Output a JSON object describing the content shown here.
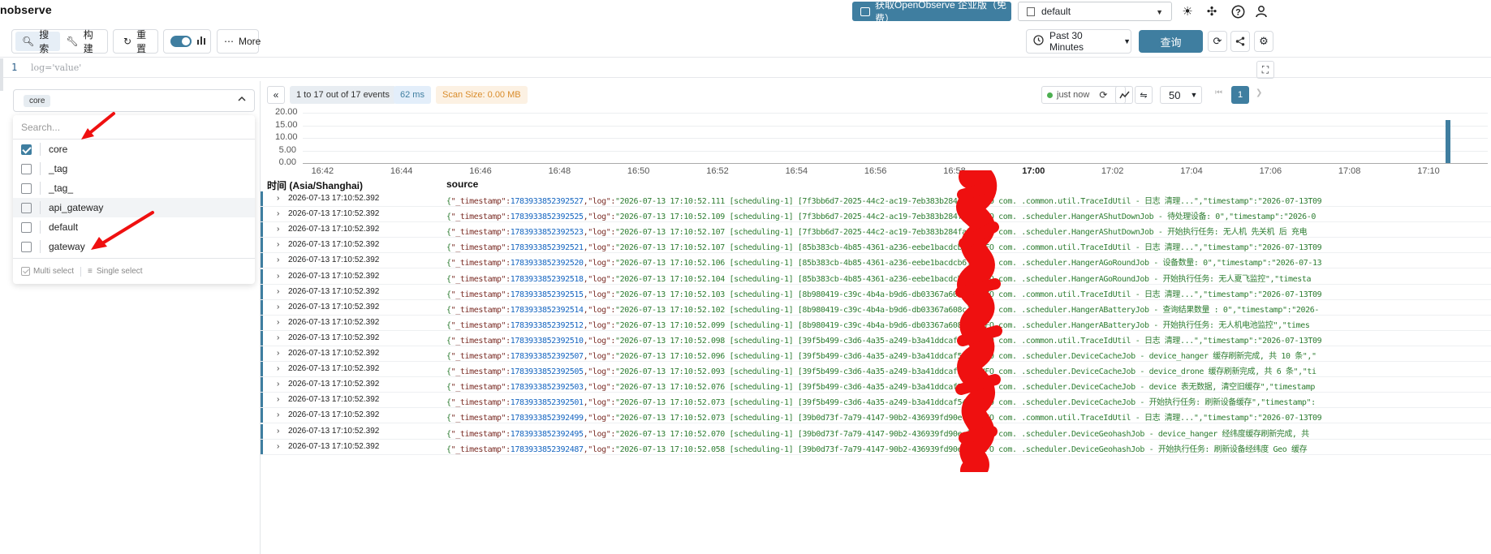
{
  "header": {
    "brand": "nobserve",
    "enterprise_btn": "获取OpenObserve 企业版（免费）",
    "org": "default"
  },
  "toolbar": {
    "search_label": "搜索",
    "build_label": "构建",
    "reset_label": "重置",
    "more_label": "More",
    "time_range": "Past 30 Minutes",
    "query_label": "查询"
  },
  "editor": {
    "line_number": "1",
    "placeholder": "log='value'"
  },
  "stream": {
    "selected_chip": "core",
    "search_placeholder": "Search...",
    "options": [
      {
        "label": "core",
        "checked": true
      },
      {
        "label": "_tag",
        "checked": false
      },
      {
        "label": "_tag_",
        "checked": false
      },
      {
        "label": "api_gateway",
        "checked": false
      },
      {
        "label": "default",
        "checked": false
      },
      {
        "label": "gateway",
        "checked": false
      }
    ],
    "multi_select": "Multi select",
    "single_select": "Single select"
  },
  "results": {
    "events_label": "1 to 17 out of 17 events",
    "took": "62 ms",
    "scan_size": "Scan Size: 0.00 MB",
    "refresh_label": "just now",
    "page_size": "50",
    "current_page": "1"
  },
  "chart_data": {
    "type": "bar",
    "y_ticks": [
      "20.00",
      "15.00",
      "10.00",
      "5.00",
      "0.00"
    ],
    "ylim": [
      0,
      20
    ],
    "x_ticks": [
      "16:42",
      "16:44",
      "16:46",
      "16:48",
      "16:50",
      "16:52",
      "16:54",
      "16:56",
      "16:58",
      "17:00",
      "17:02",
      "17:04",
      "17:06",
      "17:08",
      "17:10"
    ],
    "x_bold_tick": "17:00",
    "x_range": [
      "16:41.5",
      "17:11.5"
    ],
    "bars": [
      {
        "x": "17:10.5",
        "value": 17
      }
    ],
    "color": "#3f7ea0"
  },
  "table": {
    "col_time": "时间 (Asia/Shanghai)",
    "col_source": "source",
    "rows": [
      {
        "ts": "2026-07-13 17:10:52.392",
        "n": "1783933852392527",
        "src": "\"2026-07-13 17:10:52.111 [scheduling-1] [7f3bb6d7-2025-44c2-ac19-7eb383b284fa] INFO com.    .common.util.TraceIdUtil - 日志 清理...\",\"timestamp\":\"2026-07-13T09"
      },
      {
        "ts": "2026-07-13 17:10:52.392",
        "n": "1783933852392525",
        "src": "\"2026-07-13 17:10:52.109 [scheduling-1] [7f3bb6d7-2025-44c2-ac19-7eb383b284fa] INFO com.    .scheduler.HangerAShutDownJob - 待处理设备: 0\",\"timestamp\":\"2026-0"
      },
      {
        "ts": "2026-07-13 17:10:52.392",
        "n": "1783933852392523",
        "src": "\"2026-07-13 17:10:52.107 [scheduling-1] [7f3bb6d7-2025-44c2-ac19-7eb383b284fa] INFO com.    .scheduler.HangerAShutDownJob - 开始执行任务: 无人机 先关机 后 充电"
      },
      {
        "ts": "2026-07-13 17:10:52.392",
        "n": "1783933852392521",
        "src": "\"2026-07-13 17:10:52.107 [scheduling-1] [85b383cb-4b85-4361-a236-eebe1bacdcb6] INFO com.    .common.util.TraceIdUtil - 日志 清理...\",\"timestamp\":\"2026-07-13T09"
      },
      {
        "ts": "2026-07-13 17:10:52.392",
        "n": "1783933852392520",
        "src": "\"2026-07-13 17:10:52.106 [scheduling-1] [85b383cb-4b85-4361-a236-eebe1bacdcb6] INFO com.    .scheduler.HangerAGoRoundJob - 设备数量: 0\",\"timestamp\":\"2026-07-13"
      },
      {
        "ts": "2026-07-13 17:10:52.392",
        "n": "1783933852392518",
        "src": "\"2026-07-13 17:10:52.104 [scheduling-1] [85b383cb-4b85-4361-a236-eebe1bacdcb6] INFO com.    .scheduler.HangerAGoRoundJob - 开始执行任务: 无人夏飞监控\",\"timesta"
      },
      {
        "ts": "2026-07-13 17:10:52.392",
        "n": "1783933852392515",
        "src": "\"2026-07-13 17:10:52.103 [scheduling-1] [8b980419-c39c-4b4a-b9d6-db03367a608c] INFO com.    .common.util.TraceIdUtil - 日志 清理...\",\"timestamp\":\"2026-07-13T09"
      },
      {
        "ts": "2026-07-13 17:10:52.392",
        "n": "1783933852392514",
        "src": "\"2026-07-13 17:10:52.102 [scheduling-1] [8b980419-c39c-4b4a-b9d6-db03367a608c] INFO com.    .scheduler.HangerABatteryJob - 查询结果数量 : 0\",\"timestamp\":\"2026-"
      },
      {
        "ts": "2026-07-13 17:10:52.392",
        "n": "1783933852392512",
        "src": "\"2026-07-13 17:10:52.099 [scheduling-1] [8b980419-c39c-4b4a-b9d6-db03367a608c] INFO com.    .scheduler.HangerABatteryJob - 开始执行任务: 无人机电池监控\",\"times"
      },
      {
        "ts": "2026-07-13 17:10:52.392",
        "n": "1783933852392510",
        "src": "\"2026-07-13 17:10:52.098 [scheduling-1] [39f5b499-c3d6-4a35-a249-b3a41ddcaf54] INFO com.    .common.util.TraceIdUtil - 日志 清理...\",\"timestamp\":\"2026-07-13T09"
      },
      {
        "ts": "2026-07-13 17:10:52.392",
        "n": "1783933852392507",
        "src": "\"2026-07-13 17:10:52.096 [scheduling-1] [39f5b499-c3d6-4a35-a249-b3a41ddcaf54] INFO com.    .scheduler.DeviceCacheJob - device_hanger 缓存刷新完成, 共 10 条\",\""
      },
      {
        "ts": "2026-07-13 17:10:52.392",
        "n": "1783933852392505",
        "src": "\"2026-07-13 17:10:52.093 [scheduling-1] [39f5b499-c3d6-4a35-a249-b3a41ddcaf54] INFO com.    .scheduler.DeviceCacheJob - device_drone 缓存刷新完成, 共 6 条\",\"ti"
      },
      {
        "ts": "2026-07-13 17:10:52.392",
        "n": "1783933852392503",
        "src": "\"2026-07-13 17:10:52.076 [scheduling-1] [39f5b499-c3d6-4a35-a249-b3a41ddcaf54] INFO com.    .scheduler.DeviceCacheJob - device 表无数据, 清空旧缓存\",\"timestamp"
      },
      {
        "ts": "2026-07-13 17:10:52.392",
        "n": "1783933852392501",
        "src": "\"2026-07-13 17:10:52.073 [scheduling-1] [39f5b499-c3d6-4a35-a249-b3a41ddcaf54] INFO com.    .scheduler.DeviceCacheJob - 开始执行任务: 刷新设备缓存\",\"timestamp\":"
      },
      {
        "ts": "2026-07-13 17:10:52.392",
        "n": "1783933852392499",
        "src": "\"2026-07-13 17:10:52.073 [scheduling-1] [39b0d73f-7a79-4147-90b2-436939fd90ec] INFO com.    .common.util.TraceIdUtil - 日志 清理...\",\"timestamp\":\"2026-07-13T09"
      },
      {
        "ts": "2026-07-13 17:10:52.392",
        "n": "1783933852392495",
        "src": "\"2026-07-13 17:10:52.070 [scheduling-1] [39b0d73f-7a79-4147-90b2-436939fd90ec] INFO com.    .scheduler.DeviceGeohashJob - device_hanger 经纬度缓存刷新完成, 共"
      },
      {
        "ts": "2026-07-13 17:10:52.392",
        "n": "1783933852392487",
        "src": "\"2026-07-13 17:10:52.058 [scheduling-1] [39b0d73f-7a79-4147-90b2-436939fd90ec] INFO com.    .scheduler.DeviceGeohashJob - 开始执行任务: 刷新设备经纬度 Geo 缓存"
      }
    ]
  },
  "labels": {
    "ts_key": "\"_timestamp\"",
    "log_key": ",\"log\":"
  }
}
